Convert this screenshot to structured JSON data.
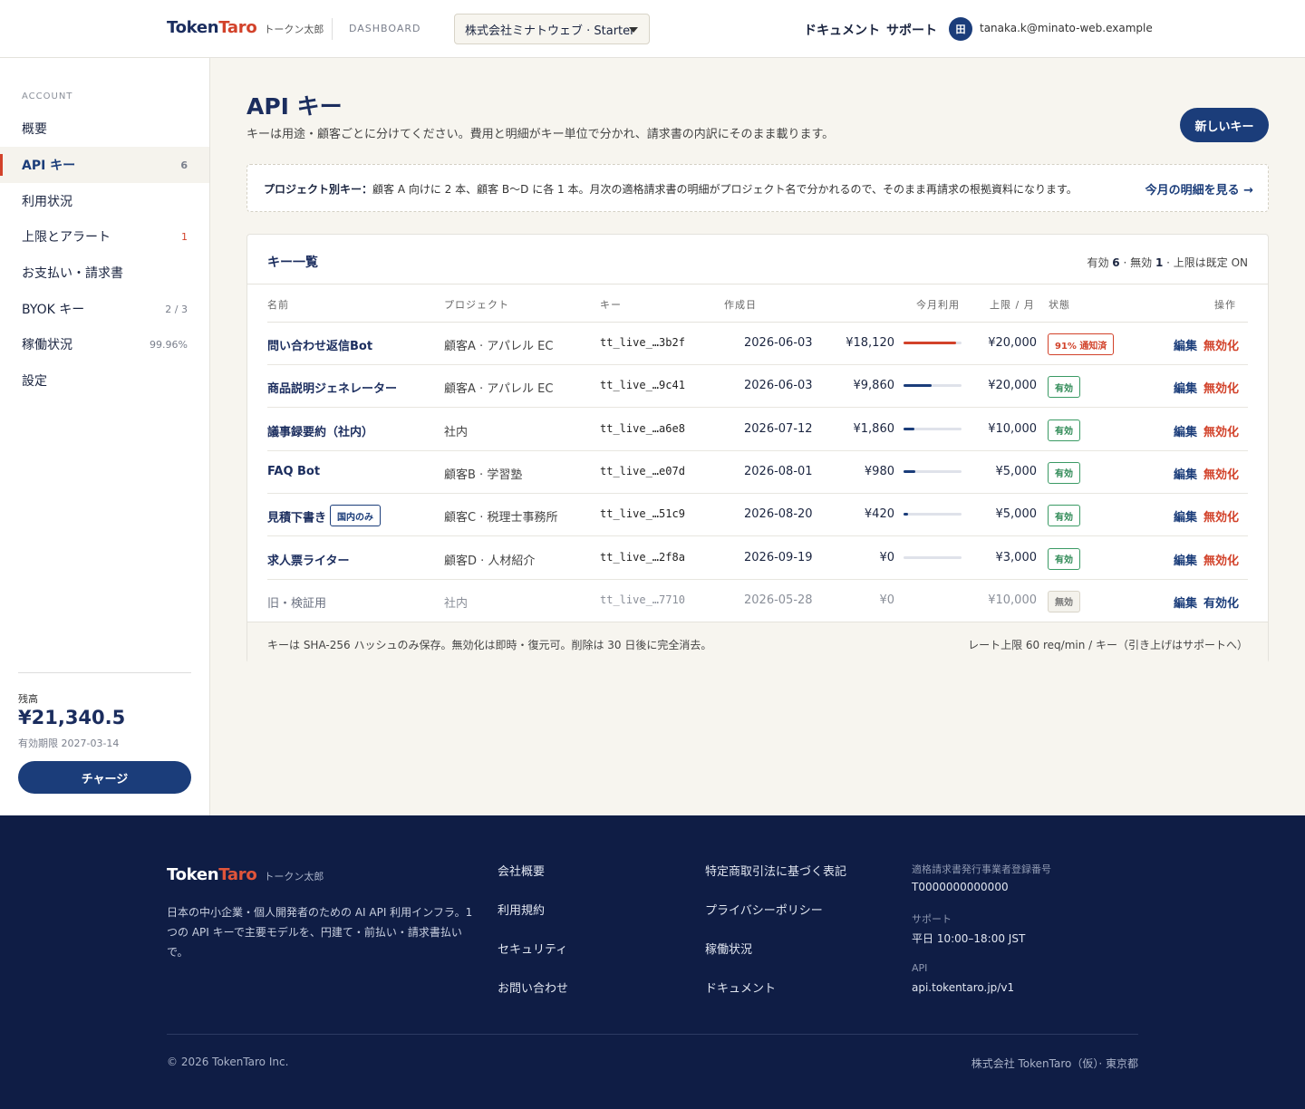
{
  "header": {
    "brand_a": "Token",
    "brand_b": "Taro",
    "brand_kana": "トークン太郎",
    "section": "DASHBOARD",
    "org": "株式会社ミナトウェブ · Starter",
    "docs": "ドキュメント",
    "support": "サポート",
    "avatar": "田",
    "email": "tanaka.k@minato-web.example"
  },
  "sidebar": {
    "section": "ACCOUNT",
    "items": [
      {
        "label": "概要",
        "count": ""
      },
      {
        "label": "API キー",
        "count": "6"
      },
      {
        "label": "利用状況",
        "count": ""
      },
      {
        "label": "上限とアラート",
        "count": "1"
      },
      {
        "label": "お支払い・請求書",
        "count": ""
      },
      {
        "label": "BYOK キー",
        "count": "2 / 3"
      },
      {
        "label": "稼働状況",
        "count": "99.96%"
      },
      {
        "label": "設定",
        "count": ""
      }
    ],
    "balance_label": "残高",
    "balance_value": "¥21,340.5",
    "balance_expiry": "有効期限 2027-03-14",
    "charge": "チャージ"
  },
  "main": {
    "title": "API キー",
    "subtitle": "キーは用途・顧客ごとに分けてください。費用と明細がキー単位で分かれ、請求書の内訳にそのまま載ります。",
    "new_key": "新しいキー",
    "note_bold": "プロジェクト別キー：",
    "note_text": "顧客 A 向けに 2 本、顧客 B〜D に各 1 本。月次の適格請求書の明細がプロジェクト名で分かれるので、そのまま再請求の根拠資料になります。",
    "note_link": "今月の明細を見る →",
    "card_title": "キー一覧",
    "stats": {
      "active_label": "有効",
      "active": "6",
      "inactive_label": "無効",
      "inactive": "1",
      "limit": "上限は既定 ON"
    },
    "columns": [
      "名前",
      "プロジェクト",
      "キー",
      "作成日",
      "今月利用",
      "上限 / 月",
      "状態",
      "操作"
    ],
    "rows": [
      {
        "name": "問い合わせ返信Bot",
        "tag": "",
        "project": "顧客A · アパレル EC",
        "key": "tt_live_…3b2f",
        "date": "2026-06-03",
        "usage": "¥18,120",
        "ratio": 0.91,
        "limit": "¥20,000",
        "status": "91% 通知済",
        "edit": "編集",
        "action": "無効化"
      },
      {
        "name": "商品説明ジェネレーター",
        "tag": "",
        "project": "顧客A · アパレル EC",
        "key": "tt_live_…9c41",
        "date": "2026-06-03",
        "usage": "¥9,860",
        "ratio": 0.49,
        "limit": "¥20,000",
        "status": "有効",
        "edit": "編集",
        "action": "無効化"
      },
      {
        "name": "議事録要約（社内）",
        "tag": "",
        "project": "社内",
        "key": "tt_live_…a6e8",
        "date": "2026-07-12",
        "usage": "¥1,860",
        "ratio": 0.19,
        "limit": "¥10,000",
        "status": "有効",
        "edit": "編集",
        "action": "無効化"
      },
      {
        "name": "FAQ Bot",
        "tag": "",
        "project": "顧客B · 学習塾",
        "key": "tt_live_…e07d",
        "date": "2026-08-01",
        "usage": "¥980",
        "ratio": 0.2,
        "limit": "¥5,000",
        "status": "有効",
        "edit": "編集",
        "action": "無効化"
      },
      {
        "name": "見積下書き",
        "tag": "国内のみ",
        "project": "顧客C · 税理士事務所",
        "key": "tt_live_…51c9",
        "date": "2026-08-20",
        "usage": "¥420",
        "ratio": 0.08,
        "limit": "¥5,000",
        "status": "有効",
        "edit": "編集",
        "action": "無効化"
      },
      {
        "name": "求人票ライター",
        "tag": "",
        "project": "顧客D · 人材紹介",
        "key": "tt_live_…2f8a",
        "date": "2026-09-19",
        "usage": "¥0",
        "ratio": 0,
        "limit": "¥3,000",
        "status": "有効",
        "edit": "編集",
        "action": "無効化"
      },
      {
        "name": "旧・検証用",
        "tag": "",
        "project": "社内",
        "key": "tt_live_…7710",
        "date": "2026-05-28",
        "usage": "¥0",
        "ratio": null,
        "limit": "¥10,000",
        "status": "無効",
        "edit": "編集",
        "action": "有効化"
      }
    ],
    "foot_left": "キーは SHA-256 ハッシュのみ保存。無効化は即時・復元可。削除は 30 日後に完全消去。",
    "foot_right": "レート上限 60 req/min / キー（引き上げはサポートへ）"
  },
  "footer": {
    "desc": "日本の中小企業・個人開発者のための AI API 利用インフラ。1 つの API キーで主要モデルを、円建て・前払い・請求書払いで。",
    "col1": [
      "会社概要",
      "利用規約",
      "セキュリティ",
      "お問い合わせ"
    ],
    "col2": [
      "特定商取引法に基づく表記",
      "プライバシーポリシー",
      "稼働状況",
      "ドキュメント"
    ],
    "reg_label": "適格請求書発行事業者登録番号",
    "reg_value": "T0000000000000",
    "support_label": "サポート",
    "support_value": "平日 10:00–18:00 JST",
    "api_label": "API",
    "api_value": "api.tokentaro.jp/v1",
    "copyright": "© 2026 TokenTaro Inc.",
    "company": "株式会社 TokenTaro（仮）· 東京都"
  }
}
